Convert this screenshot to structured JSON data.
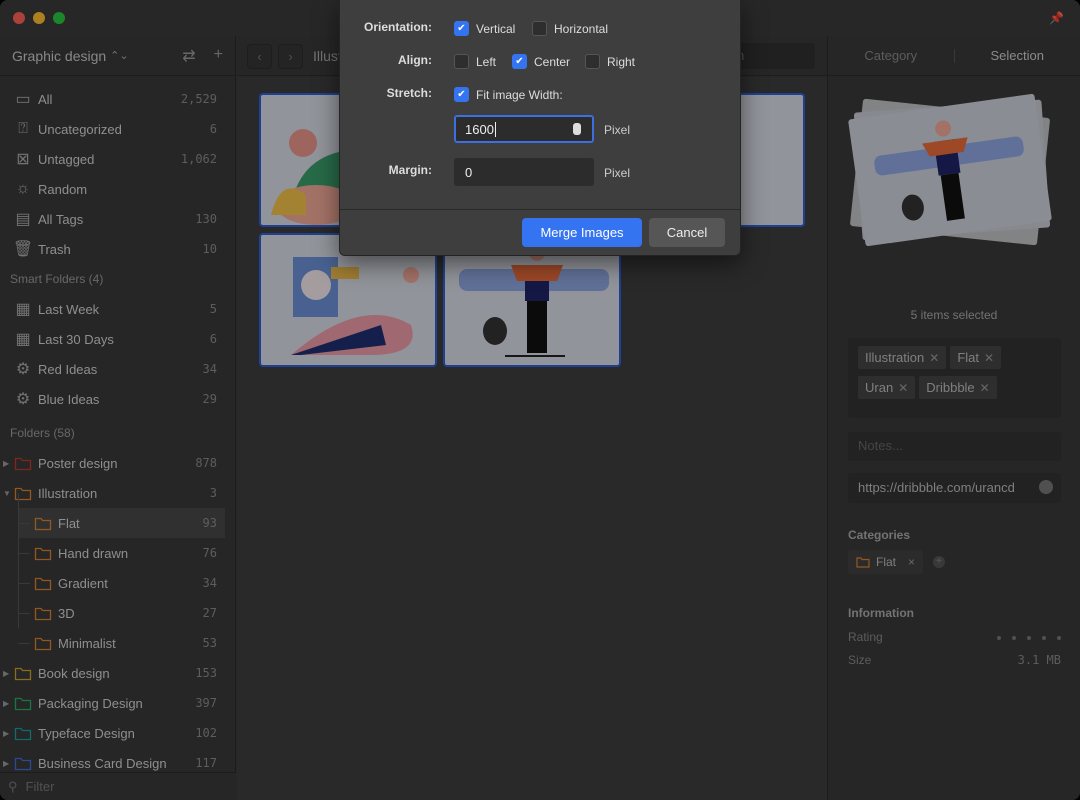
{
  "window": {
    "pin_icon": "pin-icon"
  },
  "sidebar": {
    "library_title": "Graphic design",
    "library_chevron": "⌃⌄",
    "actions": {
      "swap": "⇄",
      "add": "+"
    },
    "items": [
      {
        "label": "All",
        "count": "2,529",
        "icon": "archive-icon"
      },
      {
        "label": "Uncategorized",
        "count": "6",
        "icon": "question-box-icon"
      },
      {
        "label": "Untagged",
        "count": "1,062",
        "icon": "tag-x-icon"
      },
      {
        "label": "Random",
        "count": "",
        "icon": "lightbulb-icon"
      },
      {
        "label": "All Tags",
        "count": "130",
        "icon": "tags-icon"
      },
      {
        "label": "Trash",
        "count": "10",
        "icon": "trash-icon"
      }
    ],
    "smart_folders_title": "Smart Folders (4)",
    "smart_folders": [
      {
        "label": "Last Week",
        "count": "5",
        "icon": "calendar-7-icon"
      },
      {
        "label": "Last 30 Days",
        "count": "6",
        "icon": "calendar-31-icon"
      },
      {
        "label": "Red Ideas",
        "count": "34",
        "icon": "smart-folder-icon"
      },
      {
        "label": "Blue Ideas",
        "count": "29",
        "icon": "smart-folder-icon"
      }
    ],
    "folders_title": "Folders (58)",
    "folders": [
      {
        "label": "Poster design",
        "count": "878",
        "color": "#c0392b"
      },
      {
        "label": "Illustration",
        "count": "3",
        "color": "#d9822b"
      },
      {
        "label": "Flat",
        "count": "93",
        "color": "#d9822b"
      },
      {
        "label": "Hand drawn",
        "count": "76",
        "color": "#d9822b"
      },
      {
        "label": "Gradient",
        "count": "34",
        "color": "#d9822b"
      },
      {
        "label": "3D",
        "count": "27",
        "color": "#d9822b"
      },
      {
        "label": "Minimalist",
        "count": "53",
        "color": "#d9822b"
      },
      {
        "label": "Book design",
        "count": "153",
        "color": "#c9a227"
      },
      {
        "label": "Packaging Design",
        "count": "397",
        "color": "#27ae60"
      },
      {
        "label": "Typeface Design",
        "count": "102",
        "color": "#16a0a0"
      },
      {
        "label": "Business Card Design",
        "count": "117",
        "color": "#3b6fd6"
      }
    ],
    "filter_placeholder": "Filter"
  },
  "toolbar": {
    "back": "‹",
    "forward": "›",
    "breadcrumb": "Illustration",
    "search_placeholder": "Search"
  },
  "right_panel": {
    "tabs": [
      "Category",
      "Selection"
    ],
    "selected_count": "5 items selected",
    "tags": [
      "Illustration",
      "Flat",
      "Uran",
      "Dribbble"
    ],
    "tag_remove": "✕",
    "notes_placeholder": "Notes...",
    "url": "https://dribbble.com/urancd",
    "categories_title": "Categories",
    "category": "Flat",
    "category_remove": "×",
    "category_add": "+",
    "information_title": "Information",
    "rating_label": "Rating",
    "rating_value": 0,
    "rating_max": 5,
    "size_label": "Size",
    "size_value": "3.1 MB"
  },
  "dialog": {
    "orientation_label": "Orientation:",
    "orientation_options": [
      {
        "label": "Vertical",
        "checked": true
      },
      {
        "label": "Horizontal",
        "checked": false
      }
    ],
    "align_label": "Align:",
    "align_options": [
      {
        "label": "Left",
        "checked": false
      },
      {
        "label": "Center",
        "checked": true
      },
      {
        "label": "Right",
        "checked": false
      }
    ],
    "stretch_label": "Stretch:",
    "stretch_option": {
      "label": "Fit image Width:",
      "checked": true
    },
    "width_value": "1600",
    "width_unit": "Pixel",
    "margin_label": "Margin:",
    "margin_value": "0",
    "margin_unit": "Pixel",
    "primary_button": "Merge Images",
    "cancel_button": "Cancel",
    "checkmark": "✔"
  },
  "colors": {
    "accent": "#3574f0",
    "selection_border": "#2f5fd6"
  }
}
